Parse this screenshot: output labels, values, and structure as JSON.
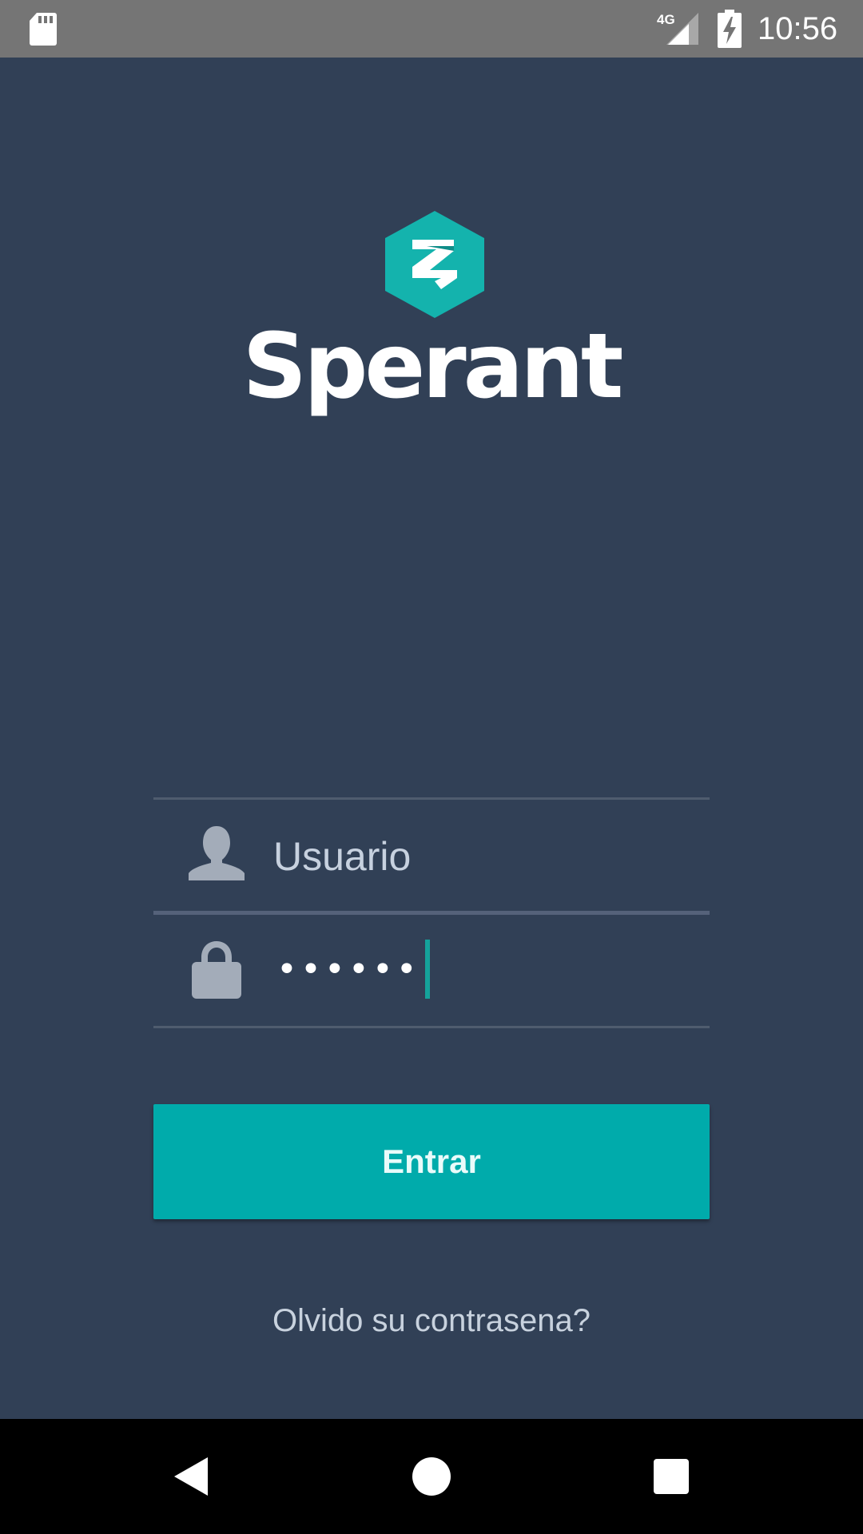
{
  "status_bar": {
    "network_label": "4G",
    "time": "10:56",
    "icons": [
      "sd-card-icon",
      "signal-4g-icon",
      "battery-charging-icon"
    ]
  },
  "logo": {
    "brand_name": "Sperant",
    "mark_color": "#14b3ad"
  },
  "login_form": {
    "username_placeholder": "Usuario",
    "password_masked": "••••••",
    "submit_label": "Entrar",
    "forgot_password_label": "Olvido su contrasena?"
  },
  "nav_bar": {
    "icons": [
      "back-icon",
      "home-icon",
      "recents-icon"
    ]
  },
  "colors": {
    "background": "#314056",
    "accent": "#00abab",
    "status_bar": "#757575",
    "nav_bar": "#000000"
  }
}
